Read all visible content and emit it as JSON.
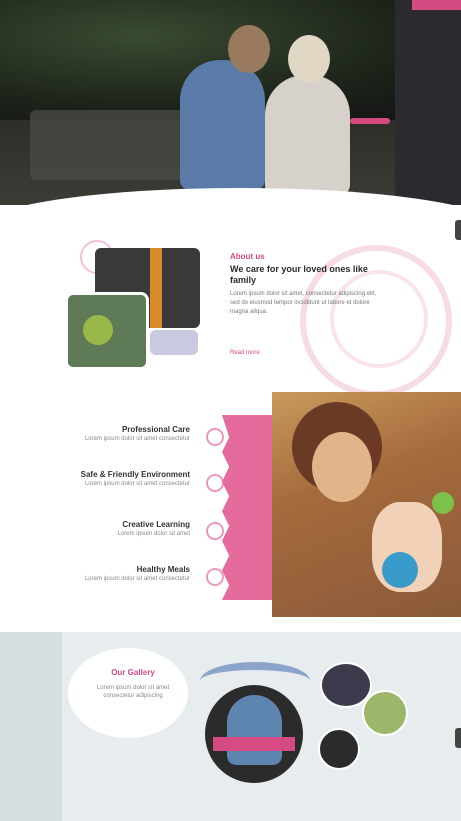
{
  "about": {
    "tag": "About us",
    "title": "We care for your loved ones like family",
    "text": "Lorem ipsum dolor sit amet, consectetur adipiscing elit, sed do eiusmod tempor incididunt ut labore et dolore magna aliqua.",
    "button": "Read more"
  },
  "features": [
    {
      "title": "Professional Care",
      "text": "Lorem ipsum dolor sit amet consectetur"
    },
    {
      "title": "Safe & Friendly Environment",
      "text": "Lorem ipsum dolor sit amet consectetur"
    },
    {
      "title": "Creative Learning",
      "text": "Lorem ipsum dolor sit amet"
    },
    {
      "title": "Healthy Meals",
      "text": "Lorem ipsum dolor sit amet consectetur"
    }
  ],
  "gallery": {
    "title": "Our Gallery",
    "subtitle": "Lorem ipsum dolor sit amet consectetur adipiscing"
  },
  "colors": {
    "accent": "#d64a84",
    "light_bg": "#e7ecee"
  }
}
